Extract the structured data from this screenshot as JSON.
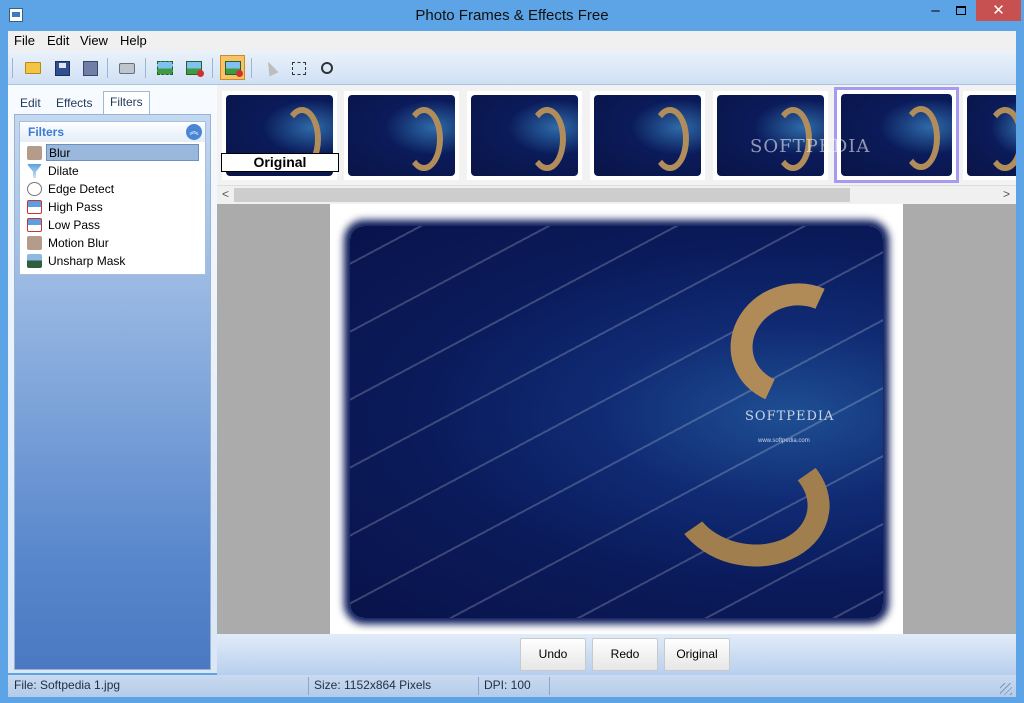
{
  "window": {
    "title": "Photo Frames & Effects Free",
    "minimize_label": "–",
    "close_label": "✕"
  },
  "menu": {
    "file": "File",
    "edit": "Edit",
    "view": "View",
    "help": "Help"
  },
  "toolbar": {
    "icons": [
      "open-folder-icon",
      "save-icon",
      "save-as-icon",
      "print-icon",
      "frame-image-icon",
      "add-image-icon",
      "effects-active-icon",
      "pointer-icon",
      "select-rectangle-icon",
      "zoom-icon"
    ]
  },
  "left_tabs": [
    "Edit",
    "Effects",
    "Filters"
  ],
  "filters": {
    "title": "Filters",
    "collapse_glyph": "︽",
    "items": [
      {
        "label": "Blur",
        "icon": "blur-icon",
        "selected": true
      },
      {
        "label": "Dilate",
        "icon": "dilate-icon"
      },
      {
        "label": "Edge Detect",
        "icon": "edge-detect-icon"
      },
      {
        "label": "High Pass",
        "icon": "high-pass-icon"
      },
      {
        "label": "Low Pass",
        "icon": "low-pass-icon"
      },
      {
        "label": "Motion Blur",
        "icon": "motion-blur-icon"
      },
      {
        "label": "Unsharp Mask",
        "icon": "unsharp-mask-icon"
      }
    ]
  },
  "thumbnails": {
    "caption": "Original",
    "watermark": "SOFTPEDIA",
    "count": 7,
    "selected_index": 5
  },
  "image": {
    "watermark": "SOFTPEDIA",
    "url": "www.softpedia.com"
  },
  "buttons": {
    "undo": "Undo",
    "redo": "Redo",
    "original": "Original"
  },
  "status": {
    "file": "File: Softpedia 1.jpg",
    "size": "Size: 1152x864 Pixels",
    "dpi": "DPI: 100"
  },
  "colors": {
    "titlebar": "#5da4e6",
    "close_button": "#c75050",
    "selection": "#9ab7dc",
    "thumb_selected": "#a59cf2"
  }
}
